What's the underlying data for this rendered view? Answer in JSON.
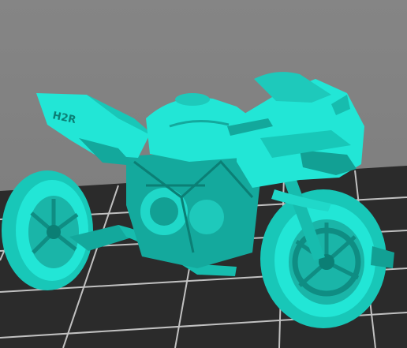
{
  "viewer": {
    "background_color": "#7e7e7e",
    "build_plate_color": "#2b2b2b",
    "grid_line_color": "#dcdcdc",
    "model_color": "#22e6d6",
    "model_shade_color": "#15b3a6",
    "model_dark_color": "#0b7f75"
  },
  "model": {
    "icon": "motorcycle-icon",
    "logo_text": "H2R"
  }
}
